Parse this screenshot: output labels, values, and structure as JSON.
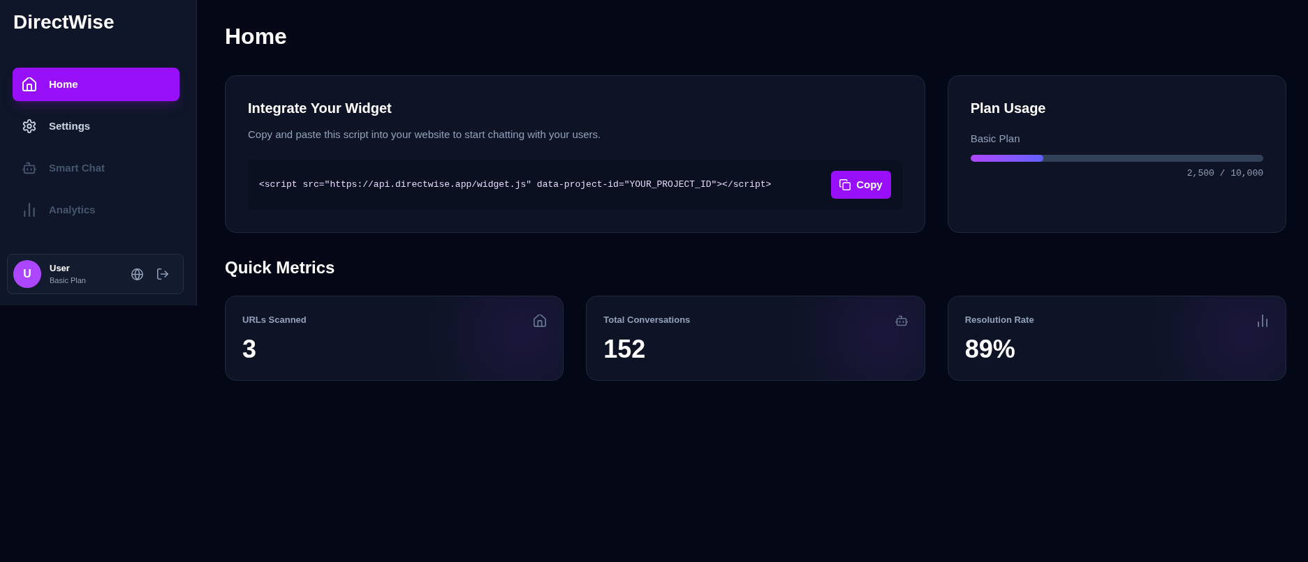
{
  "sidebar": {
    "logo": "DirectWise",
    "nav": [
      {
        "label": "Home",
        "selected": true,
        "disabled": false
      },
      {
        "label": "Settings",
        "selected": false,
        "disabled": false
      },
      {
        "label": "Smart Chat",
        "selected": false,
        "disabled": true
      },
      {
        "label": "Analytics",
        "selected": false,
        "disabled": true
      }
    ],
    "user": {
      "avatar": "U",
      "name": "User",
      "plan": "Basic Plan"
    }
  },
  "page": {
    "title": "Home"
  },
  "widget": {
    "title": "Integrate Your Widget",
    "description": "Copy and paste this script into your website to start chatting with your users.",
    "code": "<script src=\"https://api.directwise.app/widget.js\" data-project-id=\"YOUR_PROJECT_ID\"></script>",
    "copy_button": "Copy"
  },
  "plan_usage": {
    "title": "Plan Usage",
    "plan": "Basic Plan",
    "level": 0.25,
    "reading": "2,500 / 10,000"
  },
  "quick_metrics": {
    "title": "Quick Metrics",
    "metrics": [
      {
        "label": "URLs Scanned",
        "value": "3"
      },
      {
        "label": "Total Conversations",
        "value": "152"
      },
      {
        "label": "Resolution Rate",
        "value": "89%"
      }
    ]
  }
}
